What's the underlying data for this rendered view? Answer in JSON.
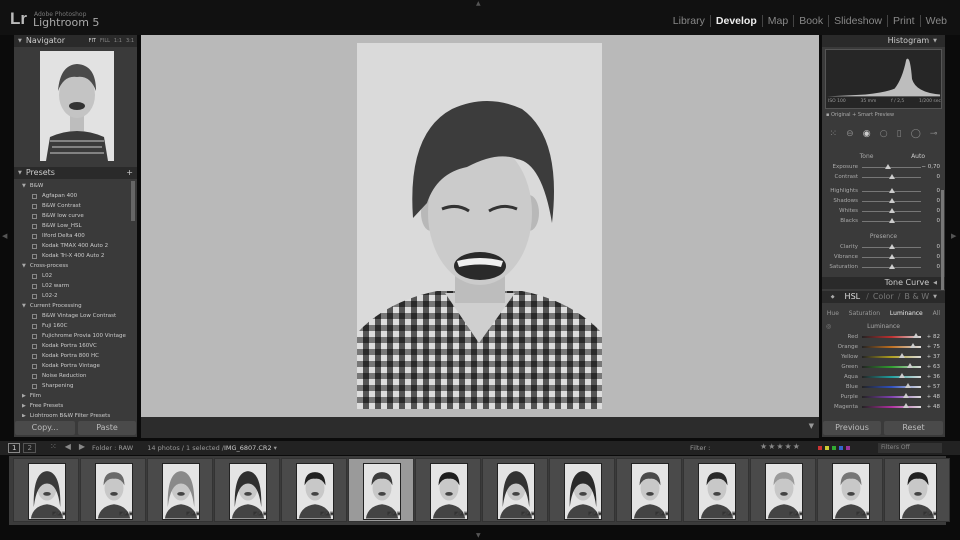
{
  "app": {
    "logo": "Lr",
    "sub": "Adobe Photoshop",
    "name": "Lightroom 5"
  },
  "modules": [
    "Library",
    "Develop",
    "Map",
    "Book",
    "Slideshow",
    "Print",
    "Web"
  ],
  "active_module": "Develop",
  "navigator": {
    "title": "Navigator",
    "zoom": [
      "FIT",
      "FILL",
      "1:1",
      "3:1"
    ]
  },
  "presets": {
    "title": "Presets",
    "add": "+",
    "groups": [
      {
        "name": "B&W",
        "open": true,
        "items": [
          "Agfapan 400",
          "B&W Contrast",
          "B&W low curve",
          "B&W Low_HSL",
          "Ilford Delta 400",
          "Kodak TMAX 400 Auto 2",
          "Kodak Tri-X 400 Auto 2"
        ]
      },
      {
        "name": "Cross-process",
        "open": true,
        "items": [
          "L02",
          "L02 warm",
          "L02-2"
        ]
      },
      {
        "name": "Current Processing",
        "open": true,
        "items": [
          "B&W Vintage Low Contrast",
          "Fuji 160C",
          "Fujichrome Provia 100 Vintage",
          "Kodak Portra 160VC",
          "Kodak Portra 800 HC",
          "Kodak Portra Vintage",
          "Noise Reduction",
          "Sharpening"
        ]
      },
      {
        "name": "Film",
        "open": false,
        "items": []
      },
      {
        "name": "Free Presets",
        "open": false,
        "items": []
      },
      {
        "name": "Lightroom B&W Filter Presets",
        "open": false,
        "items": []
      }
    ]
  },
  "buttons": {
    "copy": "Copy...",
    "paste": "Paste",
    "previous": "Previous",
    "reset": "Reset"
  },
  "histogram": {
    "title": "Histogram",
    "iso": "ISO 100",
    "focal": "35 mm",
    "aperture": "f / 2,5",
    "shutter": "1/200 sec",
    "preview": "Original + Smart Preview"
  },
  "tone": {
    "title": "Tone",
    "auto": "Auto",
    "sliders": [
      {
        "label": "Exposure",
        "value": "− 0,70",
        "pos": 0.44
      },
      {
        "label": "Contrast",
        "value": "0",
        "pos": 0.5
      },
      {
        "label": "Highlights",
        "value": "0",
        "pos": 0.5
      },
      {
        "label": "Shadows",
        "value": "0",
        "pos": 0.5
      },
      {
        "label": "Whites",
        "value": "0",
        "pos": 0.5
      },
      {
        "label": "Blacks",
        "value": "0",
        "pos": 0.5
      }
    ]
  },
  "presence": {
    "title": "Presence",
    "sliders": [
      {
        "label": "Clarity",
        "value": "0",
        "pos": 0.5
      },
      {
        "label": "Vibrance",
        "value": "0",
        "pos": 0.5
      },
      {
        "label": "Saturation",
        "value": "0",
        "pos": 0.5
      }
    ]
  },
  "tone_curve": {
    "title": "Tone Curve"
  },
  "hsl": {
    "tabs_top": [
      "HSL",
      "Color",
      "B & W"
    ],
    "tabs": [
      "Hue",
      "Saturation",
      "Luminance",
      "All"
    ],
    "active": "Luminance",
    "section": "Luminance",
    "sliders": [
      {
        "label": "Red",
        "value": "+ 82",
        "pos": 0.91,
        "color": "#c03030"
      },
      {
        "label": "Orange",
        "value": "+ 75",
        "pos": 0.87,
        "color": "#c07020"
      },
      {
        "label": "Yellow",
        "value": "+ 37",
        "pos": 0.68,
        "color": "#b0a020"
      },
      {
        "label": "Green",
        "value": "+ 63",
        "pos": 0.81,
        "color": "#30a030"
      },
      {
        "label": "Aqua",
        "value": "+ 36",
        "pos": 0.68,
        "color": "#20a0a0"
      },
      {
        "label": "Blue",
        "value": "+ 57",
        "pos": 0.78,
        "color": "#3050c0"
      },
      {
        "label": "Purple",
        "value": "+ 48",
        "pos": 0.74,
        "color": "#8040b0"
      },
      {
        "label": "Magenta",
        "value": "+ 48",
        "pos": 0.74,
        "color": "#b030a0"
      }
    ]
  },
  "filmbar": {
    "pages": [
      "1",
      "2"
    ],
    "folder": "Folder : RAW",
    "count": "14 photos / 1 selected /",
    "file": "IMG_6807.CR2",
    "filter": "Filter :",
    "filters_off": "Filters Off"
  },
  "filmstrip": {
    "count": 14,
    "selected": 5
  }
}
